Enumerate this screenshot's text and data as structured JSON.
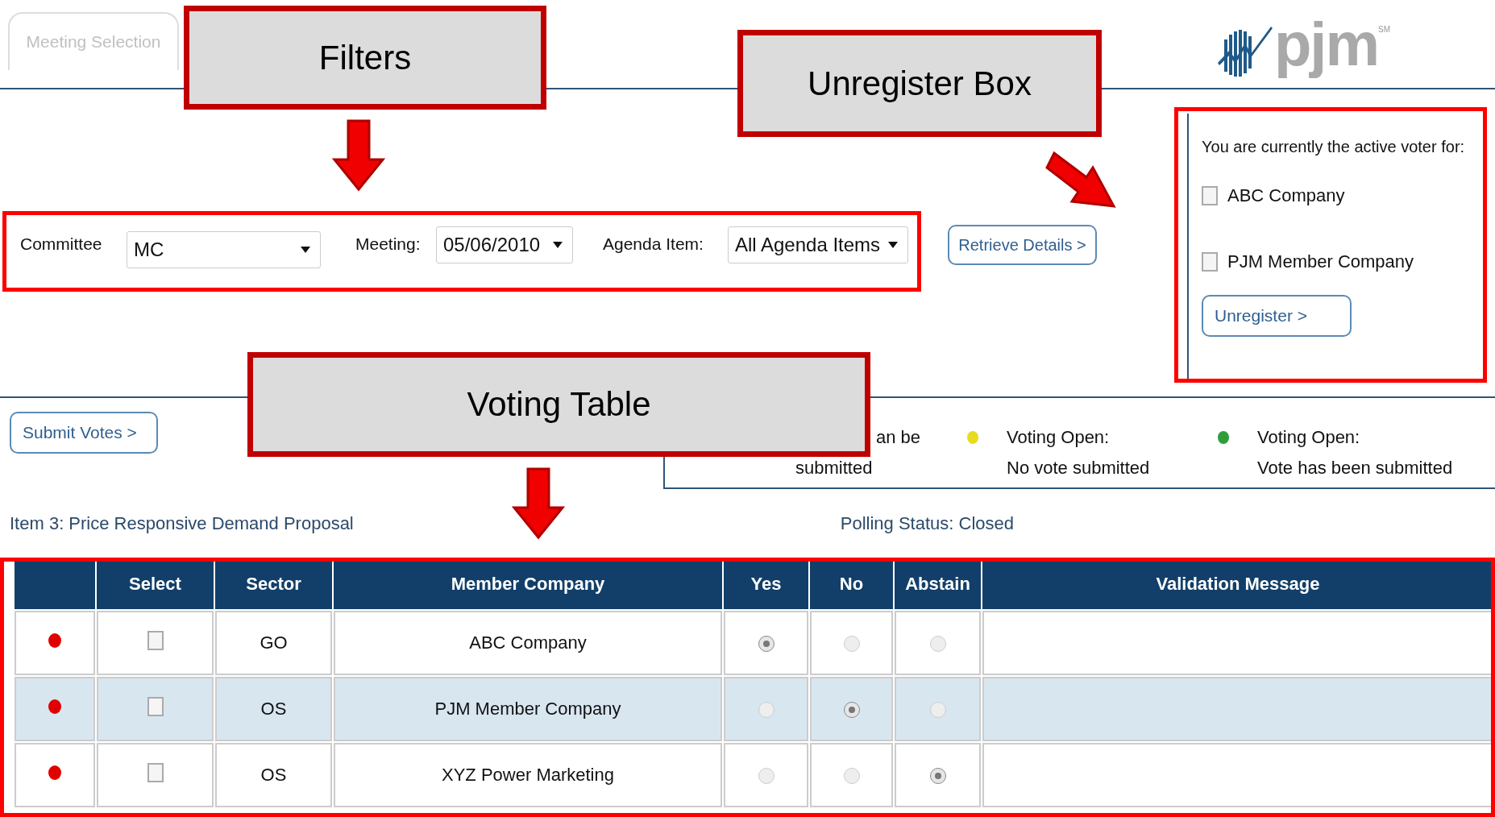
{
  "tab": {
    "label": "Meeting Selection",
    "selected": true
  },
  "logo": {
    "text": "pjm",
    "mark": "SM"
  },
  "filters": [
    {
      "label": "Committee",
      "value": "MC"
    },
    {
      "label": "Meeting:",
      "value": "05/06/2010"
    },
    {
      "label": "Agenda Item:",
      "value": "All Agenda Items"
    }
  ],
  "retrieve_button": "Retrieve Details >",
  "unregister_box": {
    "heading": "You are currently the active voter for:",
    "companies": [
      {
        "name": "ABC Company",
        "checked": false
      },
      {
        "name": "PJM Member Company",
        "checked": false
      }
    ],
    "button": "Unregister >"
  },
  "submit_button": "Submit Votes >",
  "legend": [
    {
      "lines": [
        "an be",
        "submitted"
      ]
    },
    {
      "color": "#e8dc20",
      "lines": [
        "Voting Open:",
        "No vote submitted"
      ]
    },
    {
      "color": "#2f9e3a",
      "lines": [
        "Voting Open:",
        "Vote has been submitted"
      ]
    }
  ],
  "item_title": "Item 3: Price Responsive Demand Proposal",
  "polling_status": "Polling Status: Closed",
  "table": {
    "columns": [
      "Select",
      "Sector",
      "Member Company",
      "Yes",
      "No",
      "Abstain",
      "Validation Message"
    ],
    "rows": [
      {
        "color": "#e00000",
        "checked": false,
        "highlighted": false,
        "sector": "GO",
        "company": "ABC Company",
        "votes": [
          true,
          false,
          false
        ]
      },
      {
        "color": "#e00000",
        "checked": false,
        "highlighted": true,
        "sector": "OS",
        "company": "PJM Member Company",
        "votes": [
          false,
          true,
          false
        ]
      },
      {
        "color": "#e00000",
        "checked": false,
        "highlighted": false,
        "sector": "OS",
        "company": "XYZ Power Marketing",
        "votes": [
          false,
          false,
          true
        ]
      }
    ]
  },
  "annotations": [
    {
      "text": "Filters"
    },
    {
      "text": "Unregister Box"
    },
    {
      "text": "Voting Table"
    }
  ]
}
